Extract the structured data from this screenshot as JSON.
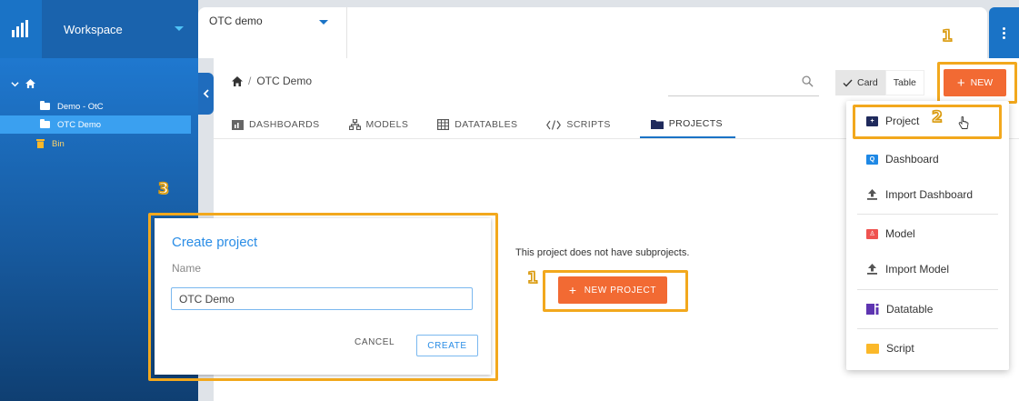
{
  "workspace": {
    "label": "Workspace"
  },
  "project_tab": {
    "label": "OTC demo"
  },
  "sidebar": {
    "items": [
      {
        "label": ""
      },
      {
        "label": "Demo - OtC"
      },
      {
        "label": "OTC Demo"
      },
      {
        "label": "Bin"
      }
    ]
  },
  "breadcrumb": {
    "separator": "/",
    "current": "OTC Demo"
  },
  "search": {
    "placeholder": ""
  },
  "view_toggle": {
    "card": "Card",
    "table": "Table"
  },
  "toolbar": {
    "new_label": "NEW"
  },
  "nav_tabs": [
    {
      "label": "DASHBOARDS"
    },
    {
      "label": "MODELS"
    },
    {
      "label": "DATATABLES"
    },
    {
      "label": "SCRIPTS"
    },
    {
      "label": "PROJECTS"
    }
  ],
  "empty_state": {
    "message": "This project does not have subprojects.",
    "button_label": "NEW PROJECT"
  },
  "new_menu": {
    "items": [
      {
        "label": "Project",
        "color": "#1f2a5c"
      },
      {
        "label": "Dashboard",
        "color": "#1e88e5"
      },
      {
        "label": "Import Dashboard",
        "color": "#555555"
      },
      {
        "label": "Model",
        "color": "#ef5350"
      },
      {
        "label": "Import Model",
        "color": "#555555"
      },
      {
        "label": "Datatable",
        "color": "#5e35b1"
      },
      {
        "label": "Script",
        "color": "#fbb829"
      }
    ]
  },
  "dialog": {
    "title": "Create project",
    "name_label": "Name",
    "name_value": "OTC Demo",
    "cancel_label": "CANCEL",
    "create_label": "CREATE"
  },
  "steps": {
    "one": "1",
    "two": "2",
    "three": "3"
  },
  "colors": {
    "accent": "#f26a33",
    "primary": "#1a73c6",
    "highlight": "#f2a81d"
  }
}
